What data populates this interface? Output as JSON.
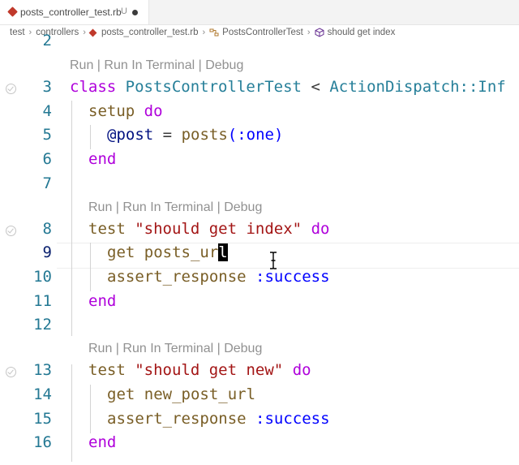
{
  "tab": {
    "filename": "posts_controller_test.rb",
    "status": "U"
  },
  "breadcrumb": [
    "test",
    "controllers",
    "posts_controller_test.rb",
    "PostsControllerTest",
    "should get index"
  ],
  "codelens": "Run | Run In Terminal | Debug",
  "line_numbers": [
    "2",
    "3",
    "4",
    "5",
    "6",
    "7",
    "8",
    "9",
    "10",
    "11",
    "12",
    "13",
    "14",
    "15",
    "16"
  ],
  "code": {
    "l3": [
      "class",
      "PostsControllerTest",
      "<",
      "ActionDispatch::Inf"
    ],
    "l4": [
      "setup",
      "do"
    ],
    "l5": [
      "@post",
      "=",
      "posts",
      "(:one)"
    ],
    "l6": "end",
    "l8": [
      "test",
      "\"should get index\"",
      "do"
    ],
    "l9": [
      "get",
      "posts_ur",
      "l"
    ],
    "l10": [
      "assert_response",
      ":success"
    ],
    "l11": "end",
    "l13": [
      "test",
      "\"should get new\"",
      "do"
    ],
    "l14": [
      "get",
      "new_post_url"
    ],
    "l15": [
      "assert_response",
      ":success"
    ],
    "l16": "end"
  },
  "colors": {
    "keyword": "#af00db",
    "class": "#267f99",
    "function": "#795e26",
    "string": "#a31515",
    "symbol": "#0000ff",
    "line_number": "#237893"
  }
}
